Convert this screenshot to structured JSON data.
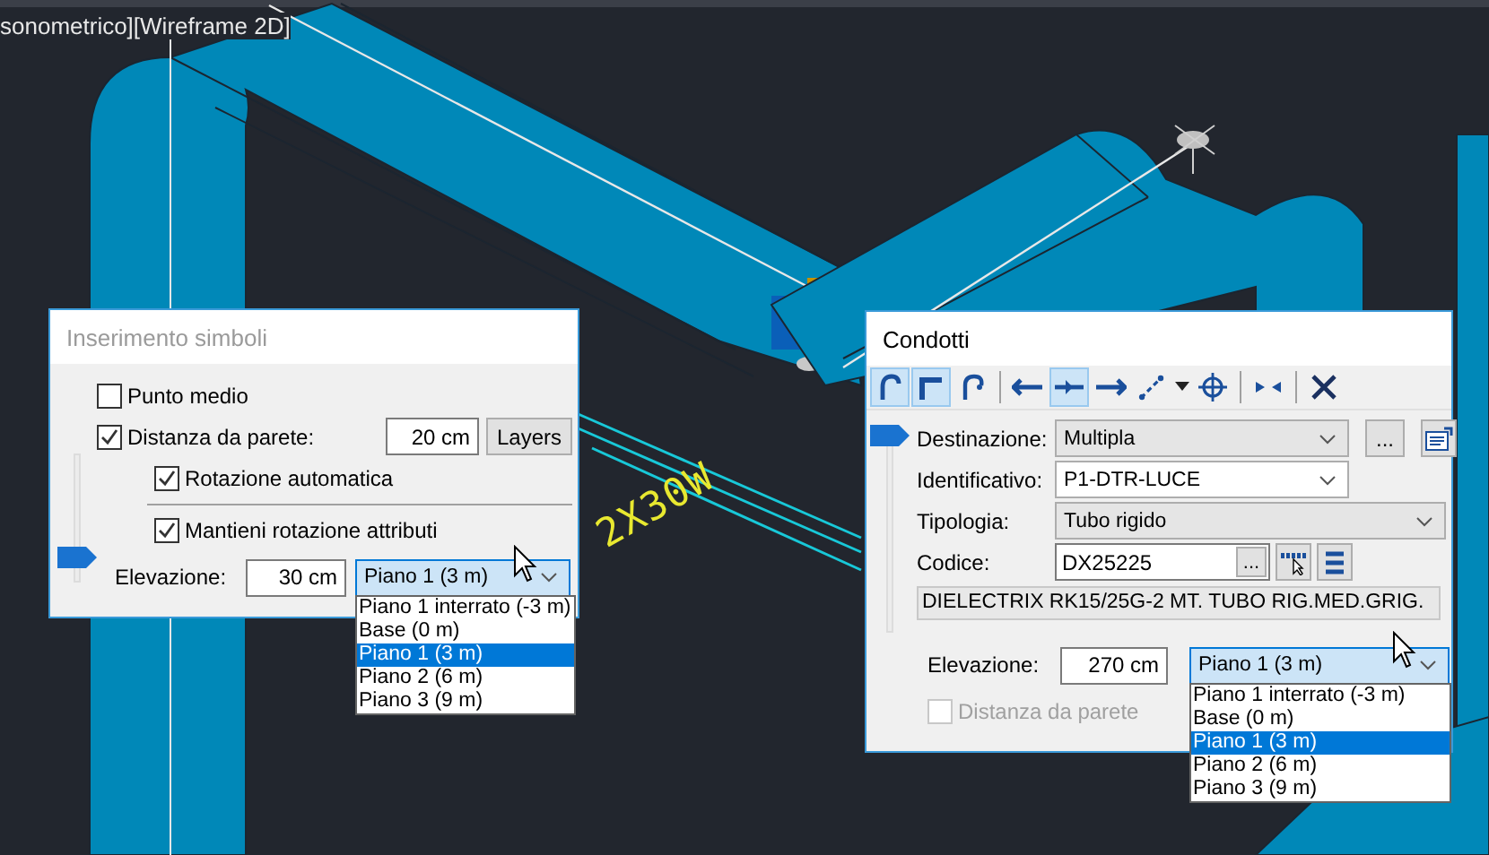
{
  "viewport": {
    "label": "sonometrico][Wireframe 2D]",
    "canvas_text": "2X30W"
  },
  "symbol_dialog": {
    "title": "Inserimento simboli",
    "active": false,
    "options": [
      {
        "label": "Punto medio",
        "checked": false,
        "indented": false
      },
      {
        "label": "Distanza da parete:",
        "checked": true,
        "indented": false
      },
      {
        "label": "Rotazione automatica",
        "checked": true,
        "indented": true
      },
      {
        "label": "Mantieni rotazione attributi",
        "checked": true,
        "indented": true
      }
    ],
    "distance_value": "20 cm",
    "layers_button": "Layers",
    "elevation_label": "Elevazione:",
    "elevation_value": "30 cm",
    "level_select": "Piano 1 (3 m)",
    "level_options": [
      {
        "label": "Piano 1 interrato (-3 m)",
        "selected": false
      },
      {
        "label": "Base (0 m)",
        "selected": false
      },
      {
        "label": "Piano 1 (3 m)",
        "selected": true
      },
      {
        "label": "Piano 2 (6 m)",
        "selected": false
      },
      {
        "label": "Piano 3 (9 m)",
        "selected": false
      }
    ]
  },
  "conduit_dialog": {
    "title": "Condotti",
    "active": true,
    "tools": [
      {
        "kind": "bend",
        "selected": true
      },
      {
        "kind": "corner",
        "selected": true
      },
      {
        "kind": "curve",
        "selected": false
      },
      {
        "kind": "separator"
      },
      {
        "kind": "left",
        "selected": false
      },
      {
        "kind": "middle",
        "selected": true
      },
      {
        "kind": "right",
        "selected": false
      },
      {
        "kind": "slope",
        "selected": false
      },
      {
        "kind": "caret",
        "selected": false
      },
      {
        "kind": "target",
        "selected": false
      },
      {
        "kind": "separator"
      },
      {
        "kind": "join",
        "selected": false
      },
      {
        "kind": "separator"
      },
      {
        "kind": "close",
        "selected": false
      }
    ],
    "fields": [
      {
        "kind": "combo",
        "label": "Destinazione:",
        "value": "Multipla",
        "editable": false
      },
      {
        "kind": "combo",
        "label": "Identificativo:",
        "value": "P1-DTR-LUCE",
        "editable": true
      },
      {
        "kind": "combo",
        "label": "Tipologia:",
        "value": "Tubo rigido",
        "editable": false
      },
      {
        "kind": "code",
        "label": "Codice:",
        "value": "DX25225",
        "browse": "..."
      }
    ],
    "dest_browse": "...",
    "description": "DIELECTRIX RK15/25G-2 MT. TUBO RIG.MED.GRIG.",
    "elevation_label": "Elevazione:",
    "elevation_value": "270 cm",
    "level_select": "Piano 1 (3 m)",
    "level_options": [
      {
        "label": "Piano 1 interrato (-3 m)",
        "selected": false
      },
      {
        "label": "Base (0 m)",
        "selected": false
      },
      {
        "label": "Piano 1 (3 m)",
        "selected": true
      },
      {
        "label": "Piano 2 (6 m)",
        "selected": false
      },
      {
        "label": "Piano 3 (9 m)",
        "selected": false
      }
    ],
    "wall_distance": {
      "label": "Distanza da parete",
      "checked": false,
      "disabled": true
    }
  }
}
